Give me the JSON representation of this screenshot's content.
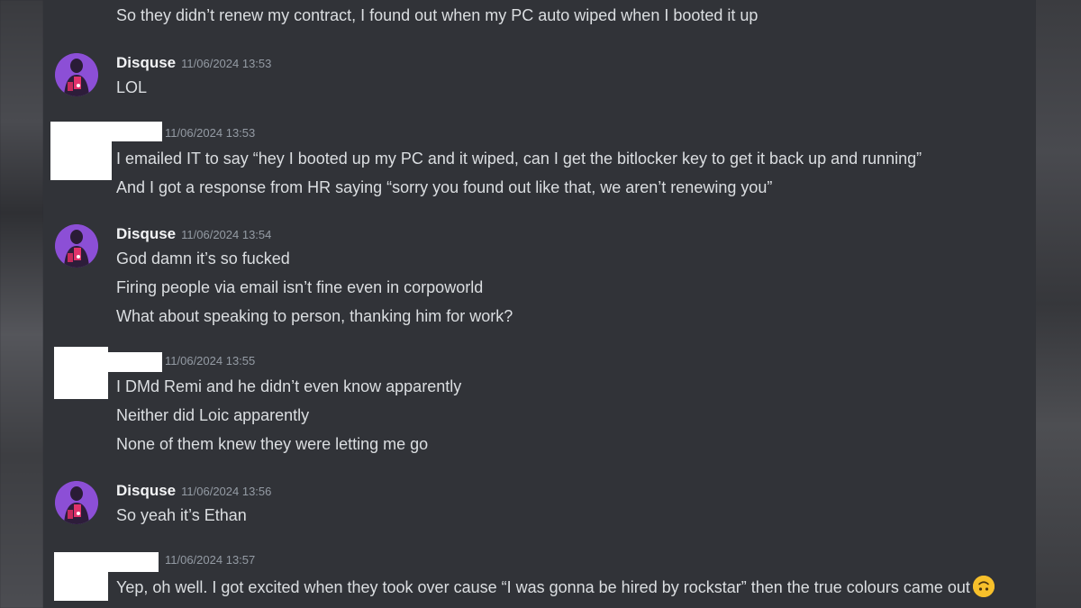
{
  "messages": [
    {
      "author": "",
      "timestamp": "",
      "lines": [
        "So they didn’t renew my contract, I found out when my PC auto wiped when I booted it up"
      ]
    },
    {
      "author": "Disquse",
      "timestamp": "11/06/2024 13:53",
      "lines": [
        "LOL"
      ]
    },
    {
      "author": "",
      "timestamp": "11/06/2024 13:53",
      "lines": [
        "I emailed IT to say “hey I booted up my PC and it wiped, can I get the bitlocker key to get it back up and running”",
        "And I got a response from HR saying “sorry you found out like that, we aren’t renewing you”"
      ]
    },
    {
      "author": "Disquse",
      "timestamp": "11/06/2024 13:54",
      "lines": [
        "God damn it’s so fucked",
        "Firing people via email isn’t fine even in corpoworld",
        "What about speaking to person, thanking him for work?"
      ]
    },
    {
      "author": "",
      "timestamp": "11/06/2024 13:55",
      "lines": [
        "I DMd Remi and he didn’t even know apparently",
        "Neither did Loic apparently",
        "None of them knew they were letting me go"
      ]
    },
    {
      "author": "Disquse",
      "timestamp": "11/06/2024 13:56",
      "lines": [
        "So yeah it’s Ethan"
      ]
    },
    {
      "author": "",
      "timestamp": "11/06/2024 13:57",
      "lines": [
        "Yep, oh well. I got excited when they took over cause “I was gonna be hired by rockstar” then the true colours came out"
      ],
      "trailing_emoji": "upside-down-face-icon"
    }
  ],
  "colors": {
    "background": "#313338",
    "text": "#dbdee1",
    "username": "#f2f3f5",
    "timestamp": "#949ba4",
    "avatar_bg": "#8c4fd6",
    "redaction": "#ffffff"
  }
}
